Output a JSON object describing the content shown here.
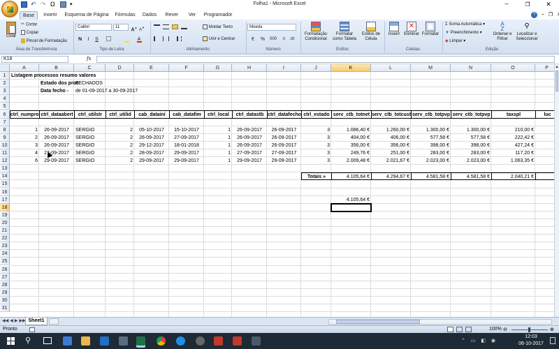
{
  "window": {
    "title": "Folha1 - Microsoft Excel",
    "qat": [
      "save-icon",
      "undo-icon",
      "redo-icon",
      "omega-icon",
      "print-icon"
    ]
  },
  "tabs": [
    "Base",
    "Inserir",
    "Esquema de Página",
    "Fórmulas",
    "Dados",
    "Rever",
    "Ver",
    "Programador"
  ],
  "active_tab": "Base",
  "ribbon": {
    "clipboard": {
      "paste": "Colar",
      "cut": "Cortar",
      "copy": "Copiar",
      "format_painter": "Pincel de Formatação",
      "label": "Área de Transferência"
    },
    "font": {
      "name": "Calibri",
      "size": "11",
      "label": "Tipo de Letra",
      "bold": "N",
      "italic": "I",
      "underline": "S"
    },
    "alignment": {
      "wrap": "Moldar Texto",
      "merge": "Unir e Centrar",
      "label": "Alinhamento"
    },
    "number": {
      "format": "Moeda",
      "percent": "%",
      "thousands": "000",
      "label": "Número"
    },
    "styles": {
      "cond": "Formatação Condicional",
      "table": "Formatar como Tabela",
      "cell": "Estilos de Célula",
      "label": "Estilos"
    },
    "cells": {
      "insert": "Inserir",
      "delete": "Eliminar",
      "format": "Formatar",
      "label": "Células"
    },
    "editing": {
      "autosum": "Soma Automática",
      "fill": "Preenchimento",
      "clear": "Limpar",
      "sort": "Ordenar e Filtrar",
      "find": "Localizar e Seleccionar",
      "label": "Edição"
    }
  },
  "formula_bar": {
    "name_box": "K18",
    "fx": "fx",
    "formula": ""
  },
  "columns": [
    "A",
    "B",
    "C",
    "D",
    "E",
    "F",
    "G",
    "H",
    "I",
    "J",
    "K",
    "L",
    "M",
    "N",
    "O",
    "P"
  ],
  "rows": [
    "1",
    "2",
    "3",
    "4",
    "5",
    "6",
    "7",
    "8",
    "9",
    "10",
    "11",
    "12",
    "13",
    "14",
    "15",
    "16",
    "17",
    "18",
    "19",
    "20",
    "21",
    "22",
    "23",
    "24",
    "25",
    "26",
    "27",
    "28",
    "29",
    "30",
    "31"
  ],
  "sheet": {
    "title": "Listagem processos resumo valores",
    "estado_label": "Estado dos proc",
    "estado_value": "FECHADOS",
    "data_label": "Data fecho -",
    "data_value": "de 01-09-2017 a 30-09-2017",
    "headers": [
      "ctrl_numproc",
      "ctrl_dataabert",
      "ctrl_utilstr",
      "ctrl_utilid",
      "cab_dataini",
      "cab_datafim",
      "ctrl_local",
      "ctrl_datastb",
      "ctrl_datafecho",
      "ctrl_estado",
      "serv_ctb_totnet",
      "serv_ctb_totcust",
      "serv_ctb_totpvp",
      "serv_ctb_totpvp",
      "taxspl",
      "luc"
    ],
    "data_rows": [
      [
        "1",
        "26-09-2017",
        "SERGIO",
        "2",
        "05-10-2017",
        "15-10-2017",
        "1",
        "26-09-2017",
        "26-09-2017",
        "3",
        "1.086,40 €",
        "1.260,00 €",
        "1.300,00 €",
        "1.300,00 €",
        "210,00 €",
        "2"
      ],
      [
        "2",
        "26-09-2017",
        "SERGIO",
        "2",
        "26-09-2017",
        "27-09-2017",
        "1",
        "26-09-2017",
        "26-09-2017",
        "3",
        "404,00 €",
        "406,00 €",
        "577,58 €",
        "577,58 €",
        "222,42 €",
        "1"
      ],
      [
        "3",
        "26-09-2017",
        "SERGIO",
        "2",
        "29-12-2017",
        "18-01-2018",
        "1",
        "26-09-2017",
        "26-09-2017",
        "3",
        "356,00 €",
        "356,00 €",
        "398,00 €",
        "398,00 €",
        "427,24 €",
        ""
      ],
      [
        "4",
        "27-09-2017",
        "SERGIO",
        "2",
        "28-09-2017",
        "29-09-2017",
        "1",
        "27-09-2017",
        "27-09-2017",
        "3",
        "249,76 €",
        "251,00 €",
        "283,00 €",
        "283,00 €",
        "117,20 €",
        ""
      ],
      [
        "6",
        "29-09-2017",
        "SERGIO",
        "2",
        "29-09-2017",
        "29-09-2017",
        "1",
        "29-09-2017",
        "29-09-2017",
        "3",
        "2.009,48 €",
        "2.021,67 €",
        "2.023,00 €",
        "2.023,00 €",
        "1.063,35 €",
        ""
      ]
    ],
    "totals_label": "Totais »",
    "totals": [
      "4.105,64 €",
      "4.294,67 €",
      "4.581,58 €",
      "4.581,58 €",
      "2.040,21 €",
      "4"
    ],
    "k17_value": "4.105,64 €"
  },
  "sheet_tabs": [
    "Sheet1"
  ],
  "status": {
    "ready": "Pronto",
    "zoom": "100%"
  },
  "taskbar": {
    "time": "12:03",
    "date": "06-10-2017"
  }
}
